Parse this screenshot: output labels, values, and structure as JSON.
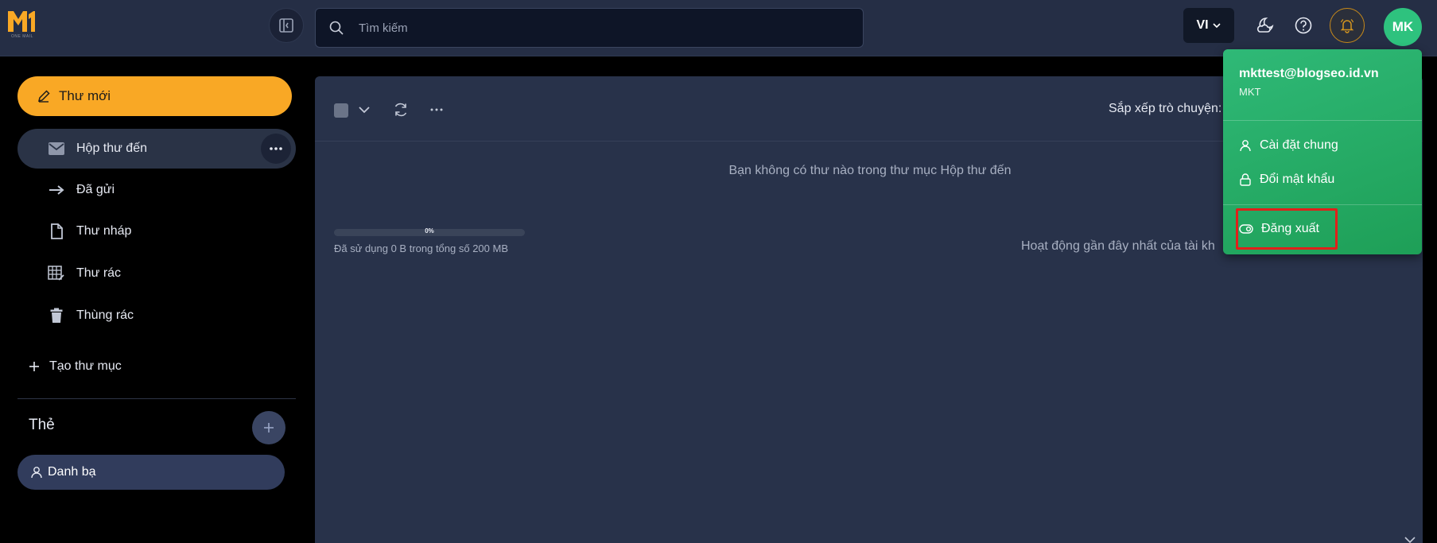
{
  "header": {
    "logo_sub": "ONE MAIL",
    "search_placeholder": "Tìm kiếm",
    "language": "VI",
    "avatar_initials": "MK"
  },
  "sidebar": {
    "compose_label": "Thư mới",
    "items": [
      {
        "label": "Hộp thư đến",
        "icon": "mail-icon"
      },
      {
        "label": "Đã gửi",
        "icon": "arrow-right-icon"
      },
      {
        "label": "Thư nháp",
        "icon": "file-icon"
      },
      {
        "label": "Thư rác",
        "icon": "spam-grid-icon"
      },
      {
        "label": "Thùng rác",
        "icon": "trash-icon"
      }
    ],
    "create_folder_label": "Tạo thư mục",
    "tags_title": "Thẻ",
    "tags": [
      {
        "label": "Danh bạ",
        "icon": "user-icon"
      }
    ]
  },
  "main": {
    "sort_label": "Sắp xếp trò chuyện:",
    "empty_message": "Bạn không có thư nào trong thư mục Hộp thư đến",
    "storage": {
      "percent_label": "0%",
      "used_fraction": 0,
      "text": "Đã sử dụng 0 B trong tổng số 200 MB"
    },
    "activity_text": "Hoạt động gần đây nhất của tài kh"
  },
  "user_menu": {
    "email": "mkttest@blogseo.id.vn",
    "name": "MKT",
    "items": [
      {
        "label": "Cài đặt chung",
        "icon": "user-icon"
      },
      {
        "label": "Đổi mật khẩu",
        "icon": "lock-icon"
      }
    ],
    "logout_label": "Đăng xuất"
  },
  "colors": {
    "accent_yellow": "#f9a825",
    "accent_green": "#2ec27e",
    "highlight_red": "#e0201a",
    "panel_bg": "#28324a",
    "header_bg": "#252e45"
  }
}
